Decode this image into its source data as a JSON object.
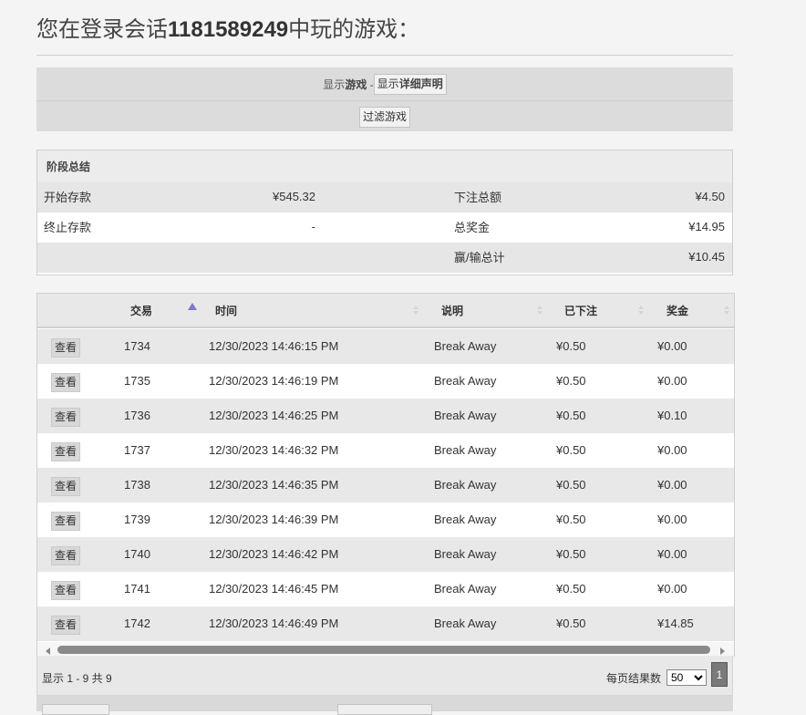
{
  "page": {
    "title_prefix": "您在登录会话",
    "session_id": "1181589249",
    "title_suffix": "中玩的游戏："
  },
  "toolbar": {
    "show_label_pre": "显示",
    "show_label_bold": "游戏",
    "show_label_sep": " - ",
    "detail_btn_pre": "显示",
    "detail_btn_bold": "详细声明",
    "filter_btn": "过滤游戏"
  },
  "summary": {
    "header": "阶段总结",
    "start_balance_label": "开始存款",
    "start_balance_value": "¥545.32",
    "end_balance_label": "终止存款",
    "end_balance_value": "-",
    "total_bet_label": "下注总额",
    "total_bet_value": "¥4.50",
    "total_win_label": "总奖金",
    "total_win_value": "¥14.95",
    "net_label": "赢/输总计",
    "net_value": "¥10.45"
  },
  "grid": {
    "columns": [
      "交易",
      "时间",
      "说明",
      "已下注",
      "奖金"
    ],
    "view_label": "查看",
    "rows": [
      {
        "id": "1734",
        "time": "12/30/2023 14:46:15 PM",
        "desc": "Break Away",
        "bet": "¥0.50",
        "win": "¥0.00"
      },
      {
        "id": "1735",
        "time": "12/30/2023 14:46:19 PM",
        "desc": "Break Away",
        "bet": "¥0.50",
        "win": "¥0.00"
      },
      {
        "id": "1736",
        "time": "12/30/2023 14:46:25 PM",
        "desc": "Break Away",
        "bet": "¥0.50",
        "win": "¥0.10"
      },
      {
        "id": "1737",
        "time": "12/30/2023 14:46:32 PM",
        "desc": "Break Away",
        "bet": "¥0.50",
        "win": "¥0.00"
      },
      {
        "id": "1738",
        "time": "12/30/2023 14:46:35 PM",
        "desc": "Break Away",
        "bet": "¥0.50",
        "win": "¥0.00"
      },
      {
        "id": "1739",
        "time": "12/30/2023 14:46:39 PM",
        "desc": "Break Away",
        "bet": "¥0.50",
        "win": "¥0.00"
      },
      {
        "id": "1740",
        "time": "12/30/2023 14:46:42 PM",
        "desc": "Break Away",
        "bet": "¥0.50",
        "win": "¥0.00"
      },
      {
        "id": "1741",
        "time": "12/30/2023 14:46:45 PM",
        "desc": "Break Away",
        "bet": "¥0.50",
        "win": "¥0.00"
      },
      {
        "id": "1742",
        "time": "12/30/2023 14:46:49 PM",
        "desc": "Break Away",
        "bet": "¥0.50",
        "win": "¥14.85"
      }
    ]
  },
  "footer": {
    "info": "显示 1 - 9 共 9",
    "per_page_label": "每页结果数",
    "per_page_value": "50",
    "current_page": "1"
  }
}
